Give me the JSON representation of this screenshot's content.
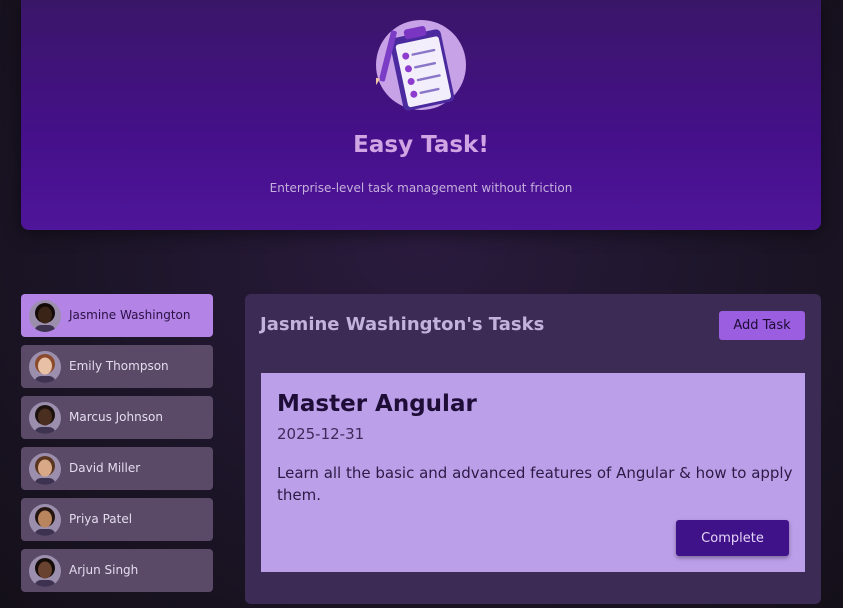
{
  "header": {
    "logo_icon": "clipboard-checklist-icon",
    "title": "Easy Task!",
    "subtitle": "Enterprise-level task management without friction"
  },
  "users": [
    {
      "name": "Jasmine Washington",
      "selected": true,
      "avatar_skin": "#3a2418",
      "avatar_hair": "#120a07"
    },
    {
      "name": "Emily Thompson",
      "selected": false,
      "avatar_skin": "#e7c0a6",
      "avatar_hair": "#8a4a2b"
    },
    {
      "name": "Marcus Johnson",
      "selected": false,
      "avatar_skin": "#4a2e20",
      "avatar_hair": "#1b120d"
    },
    {
      "name": "David Miller",
      "selected": false,
      "avatar_skin": "#d9a987",
      "avatar_hair": "#5a3520"
    },
    {
      "name": "Priya Patel",
      "selected": false,
      "avatar_skin": "#b9855f",
      "avatar_hair": "#241510"
    },
    {
      "name": "Arjun Singh",
      "selected": false,
      "avatar_skin": "#6a4230",
      "avatar_hair": "#140c08"
    }
  ],
  "tasks_panel": {
    "title": "Jasmine Washington's Tasks",
    "add_label": "Add Task"
  },
  "task": {
    "name": "Master Angular",
    "date": "2025-12-31",
    "description": "Learn all the basic and advanced features of Angular & how to apply them.",
    "complete_label": "Complete"
  },
  "colors": {
    "accent": "#9b5ee0",
    "selected_user": "#b384e6",
    "header": "#45108a"
  }
}
